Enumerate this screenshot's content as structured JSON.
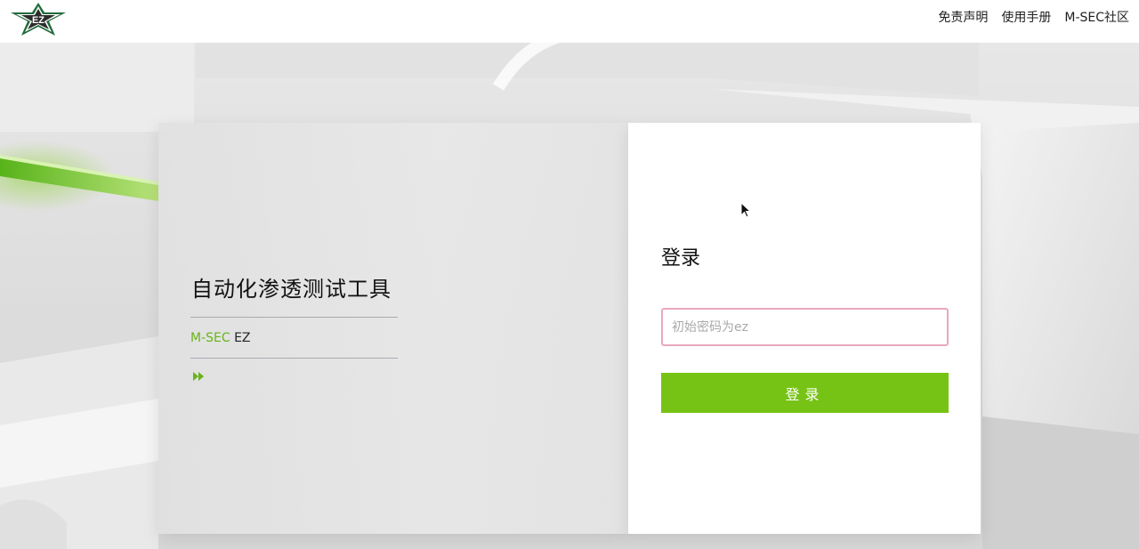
{
  "header": {
    "logo_text": "EZ",
    "nav": [
      {
        "label": "免责声明"
      },
      {
        "label": "使用手册"
      },
      {
        "label": "M-SEC社区"
      }
    ]
  },
  "hero": {
    "title": "自动化渗透测试工具",
    "brand": "M-SEC",
    "product": " EZ"
  },
  "login": {
    "title": "登录",
    "password_placeholder": "初始密码为ez",
    "password_value": "",
    "button_label": "登录"
  },
  "colors": {
    "accent": "#77c315",
    "brand_text": "#69b31a",
    "input_border": "#e7a8c0"
  },
  "icons": {
    "logo": "ez-star-logo-icon",
    "hero_arrow": "double-arrow-right-icon",
    "cursor": "mouse-pointer-icon"
  }
}
